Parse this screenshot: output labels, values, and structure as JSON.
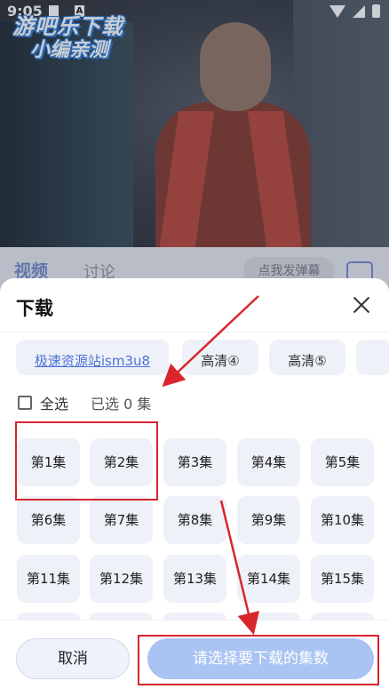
{
  "status_bar": {
    "time": "9:05",
    "notification_letter": "A"
  },
  "watermark": {
    "line1": "游吧乐下载",
    "line2": "小编亲测"
  },
  "page_tabs": {
    "video": "视频",
    "discussion": "讨论",
    "danmu_button": "点我发弹幕"
  },
  "sheet": {
    "title": "下载",
    "sources": [
      "极速资源站ism3u8",
      "高清④",
      "高清⑤",
      ""
    ],
    "active_source": "极速资源站ism3u8",
    "select_all": "全选",
    "selected_count": "已选 0 集",
    "episodes": [
      "第1集",
      "第2集",
      "第3集",
      "第4集",
      "第5集",
      "第6集",
      "第7集",
      "第8集",
      "第9集",
      "第10集",
      "第11集",
      "第12集",
      "第13集",
      "第14集",
      "第15集"
    ],
    "cancel": "取消",
    "confirm": "请选择要下载的集数"
  },
  "colors": {
    "accent": "#4a73d8",
    "annotation": "#d8262c",
    "confirm_disabled": "#a9c3f2"
  }
}
